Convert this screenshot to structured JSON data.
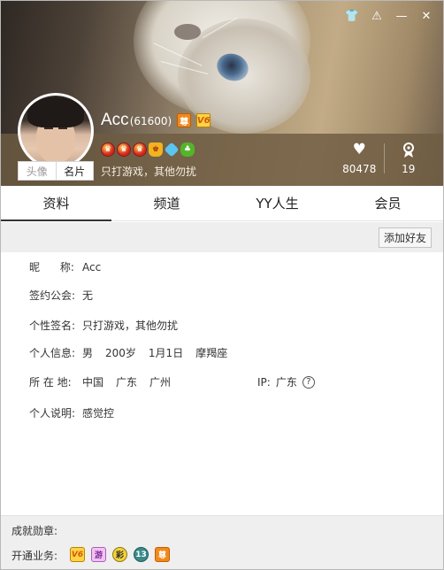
{
  "window_controls": {
    "skin": "👕",
    "report": "⚠",
    "minimize": "—",
    "close": "✕"
  },
  "profile": {
    "nickname": "Acc",
    "yy_id": "(61600)",
    "badge_zun": "尊",
    "badge_vip": "V6",
    "signature": "只打游戏，其他勿扰",
    "avatar_tabs": [
      "头像",
      "名片"
    ],
    "likes_icon": "heart-icon",
    "likes": "80478",
    "medal_count_icon": "medal-icon",
    "medal_count": "19"
  },
  "tabs": [
    "资料",
    "频道",
    "YY人生",
    "会员"
  ],
  "toolbar": {
    "add_friend": "添加好友"
  },
  "info": {
    "nickname_label": "昵      称:",
    "nickname_value": "Acc",
    "guild_label": "签约公会:",
    "guild_value": "无",
    "signature_label": "个性签名:",
    "signature_value": "只打游戏，其他勿扰",
    "personal_label": "个人信息:",
    "gender": "男",
    "age": "200岁",
    "birthday": "1月1日",
    "zodiac": "摩羯座",
    "location_label": "所 在 地:",
    "country": "中国",
    "province": "广东",
    "city": "广州",
    "ip_label": "IP:",
    "ip_value": "广东",
    "desc_label": "个人说明:",
    "desc_value": "感觉控"
  },
  "footer": {
    "achievements_label": "成就勋章:",
    "services_label": "开通业务:",
    "services": [
      "V6",
      "游",
      "彩",
      "13",
      "尊"
    ]
  },
  "colors": {
    "accent": "#f08a1c",
    "header_overlay": "#6e5c42"
  }
}
